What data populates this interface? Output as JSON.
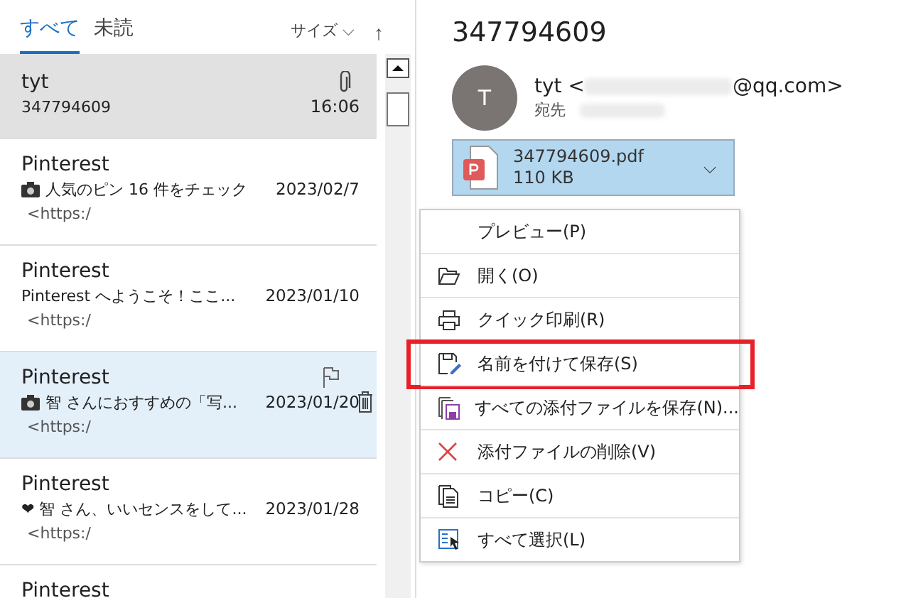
{
  "list_header": {
    "tabs": [
      {
        "label": "すべて",
        "selected": true
      },
      {
        "label": "未読",
        "selected": false
      }
    ],
    "sort_label": "サイズ",
    "sort_caret": "⌵",
    "sort_arrow": "↑"
  },
  "messages": [
    {
      "sender": "tyt",
      "preview": "347794609",
      "date": "16:06",
      "selected": true,
      "hovered": false,
      "attachment": true,
      "camera": false
    },
    {
      "sender": "Pinterest",
      "preview": "人気のピン 16 件をチェック",
      "date": "2023/02/7",
      "snippet": "<https:/",
      "selected": false,
      "hovered": false,
      "attachment": false,
      "camera": true
    },
    {
      "sender": "Pinterest",
      "preview": "Pinterest へようこそ！ここ...",
      "date": "2023/01/10",
      "snippet": "<https:/",
      "selected": false,
      "hovered": false,
      "attachment": false,
      "camera": false
    },
    {
      "sender": "Pinterest",
      "preview": "智 さんにおすすめの「写...",
      "date": "2023/01/20",
      "snippet": "<https:/",
      "selected": false,
      "hovered": true,
      "attachment": false,
      "camera": true
    },
    {
      "sender": "Pinterest",
      "preview": "❤ 智 さん、いいセンスをして...",
      "date": "2023/01/28",
      "snippet": "<https:/",
      "selected": false,
      "hovered": false,
      "attachment": false,
      "camera": false
    },
    {
      "sender": "Pinterest",
      "selected": false,
      "hovered": false,
      "attachment": false
    }
  ],
  "reading_pane": {
    "subject": "347794609",
    "avatar_initial": "T",
    "sender_name": "tyt <",
    "sender_domain": "@qq.com>",
    "to_label": "宛先",
    "attachment": {
      "name": "347794609.pdf",
      "size": "110 KB",
      "caret": "⌵"
    }
  },
  "context_menu": [
    {
      "label": "プレビュー(P)",
      "highlighted": false
    },
    {
      "label": "開く(O)",
      "highlighted": false
    },
    {
      "label": "クイック印刷(R)",
      "highlighted": false
    },
    {
      "label": "名前を付けて保存(S)",
      "highlighted": true
    },
    {
      "label": "すべての添付ファイルを保存(N)...",
      "highlighted": false
    },
    {
      "label": "添付ファイルの削除(V)",
      "highlighted": false
    },
    {
      "label": "コピー(C)",
      "highlighted": false
    },
    {
      "label": "すべて選択(L)",
      "highlighted": false
    }
  ]
}
